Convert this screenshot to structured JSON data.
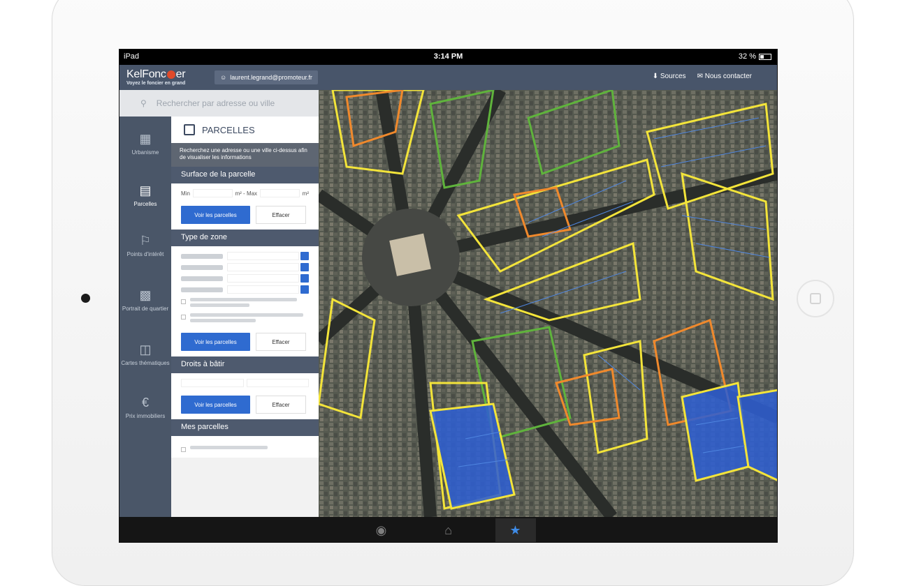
{
  "device": {
    "status_left": "iPad",
    "time": "3:14 PM",
    "battery": "32 %"
  },
  "header": {
    "logo": {
      "brand_prefix": "KelFonc",
      "brand_suffix": "er",
      "tagline": "Voyez le foncier en grand"
    },
    "user_email": "laurent.legrand@promoteur.fr",
    "links": [
      {
        "label": "Sources",
        "icon": "download-icon"
      },
      {
        "label": "Nous contacter",
        "icon": "mail-icon"
      }
    ]
  },
  "search": {
    "placeholder": "Rechercher par adresse ou ville"
  },
  "sidebar": {
    "items": [
      {
        "label": "Urbanisme",
        "icon": "building-icon",
        "active": false
      },
      {
        "label": "Parcelles",
        "icon": "parcel-icon",
        "active": true
      },
      {
        "label": "Points d'intérêt",
        "icon": "flag-icon",
        "active": false
      },
      {
        "label": "Portrait de quartier",
        "icon": "chart-icon",
        "active": false
      },
      {
        "label": "Cartes thématiques",
        "icon": "map-icon",
        "active": false
      },
      {
        "label": "Prix immobiliers",
        "icon": "euro-icon",
        "active": false
      }
    ]
  },
  "panel": {
    "title": "PARCELLES",
    "info": "Recherchez une adresse ou une ville ci-dessus afin de visualiser les informations",
    "surface": {
      "title": "Surface de la parcelle",
      "min_label": "Min",
      "unit_max": "m² - Max",
      "unit": "m²",
      "btn_primary": "Voir les parcelles",
      "btn_secondary": "Effacer"
    },
    "zone": {
      "title": "Type de zone",
      "btn_primary": "Voir les parcelles",
      "btn_secondary": "Effacer"
    },
    "droits": {
      "title": "Droits à bâtir",
      "btn_primary": "Voir les parcelles",
      "btn_secondary": "Effacer"
    },
    "mes": {
      "title": "Mes parcelles"
    }
  },
  "tabbar": {
    "tabs": [
      {
        "icon": "camera-icon",
        "selected": false
      },
      {
        "icon": "home-icon",
        "selected": false
      },
      {
        "icon": "star-icon",
        "selected": true
      }
    ]
  },
  "colors": {
    "accent": "#2f6bd0",
    "header": "#48556a",
    "sidebar": "#4a5668",
    "parcel_yellow": "#f3e43a",
    "parcel_orange": "#f0892c",
    "parcel_green": "#5fb33c",
    "parcel_blue": "#4f86e0"
  }
}
